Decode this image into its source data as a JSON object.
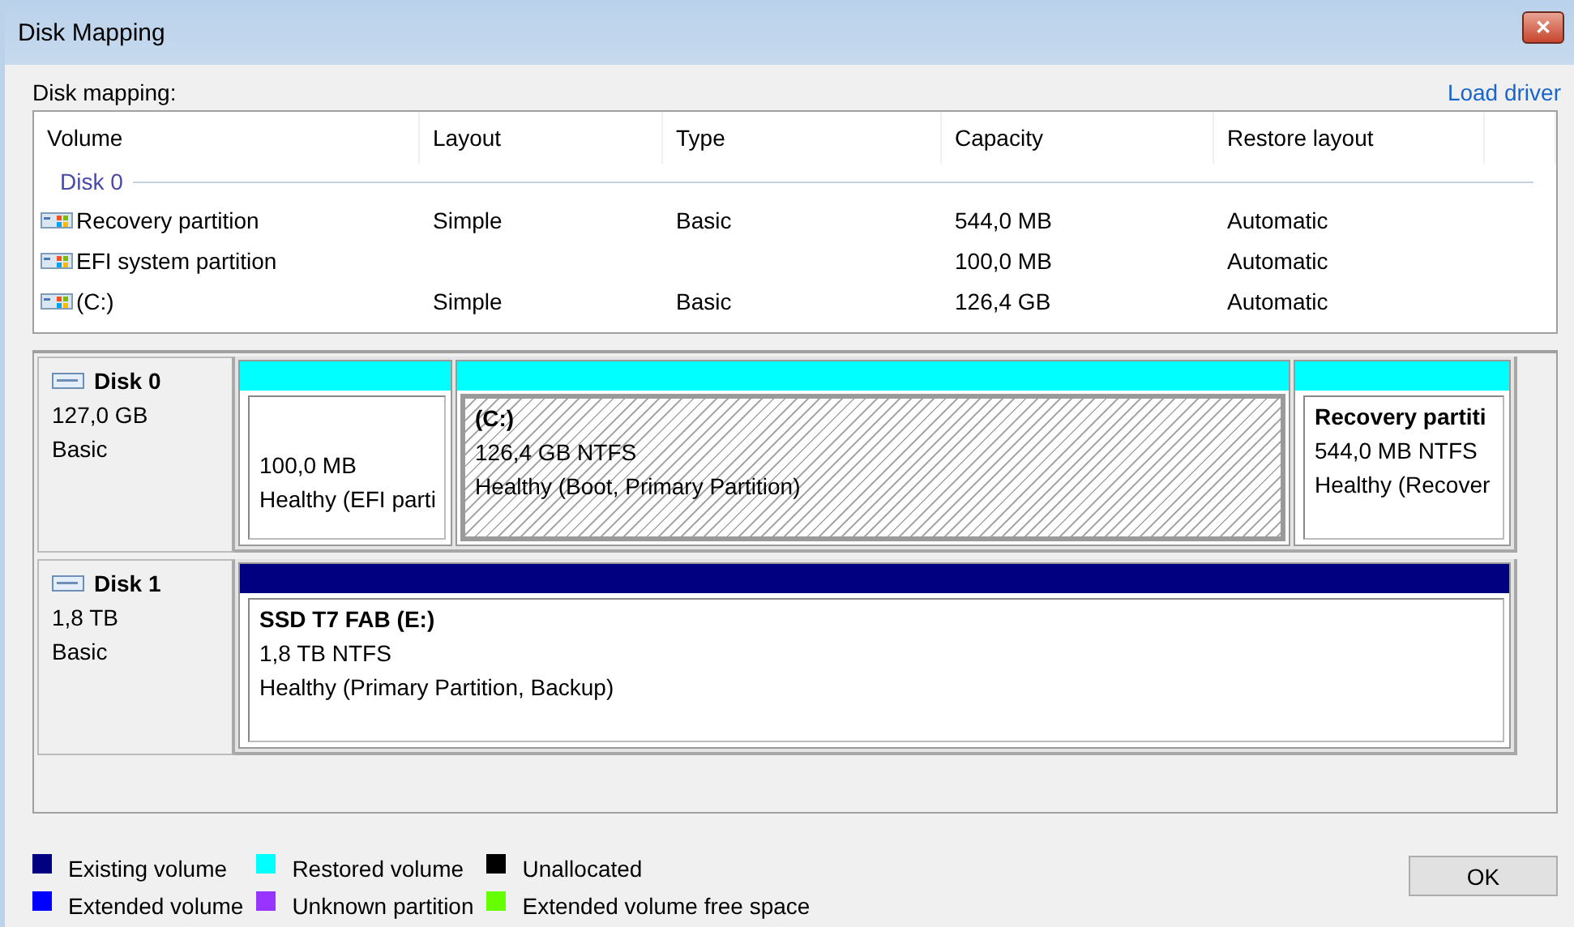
{
  "window": {
    "title": "Disk Mapping",
    "close": "✕"
  },
  "header": {
    "label": "Disk mapping:",
    "link": "Load driver"
  },
  "table": {
    "columns": [
      "Volume",
      "Layout",
      "Type",
      "Capacity",
      "Restore layout"
    ],
    "groups": [
      {
        "name": "Disk 0",
        "rows": [
          {
            "volume": "Recovery partition",
            "layout": "Simple",
            "type": "Basic",
            "capacity": "544,0 MB",
            "restore": "Automatic"
          },
          {
            "volume": "EFI system partition",
            "capacity": "100,0 MB",
            "restore": "Automatic"
          },
          {
            "volume": "(C:)",
            "layout": "Simple",
            "type": "Basic",
            "capacity": "126,4 GB",
            "restore": "Automatic"
          }
        ]
      }
    ]
  },
  "disks": [
    {
      "name": "Disk 0",
      "size": "127,0 GB",
      "type": "Basic",
      "partitions": [
        {
          "size": "100,0 MB",
          "status": "Healthy (EFI parti",
          "color": "#00ffff",
          "selected": false
        },
        {
          "name": "(C:)",
          "size": "126,4 GB NTFS",
          "status": "Healthy (Boot, Primary Partition)",
          "color": "#00ffff",
          "selected": true
        },
        {
          "name": "Recovery partiti",
          "size": "544,0 MB NTFS",
          "status": "Healthy (Recover",
          "color": "#00ffff",
          "selected": false
        }
      ]
    },
    {
      "name": "Disk 1",
      "size": "1,8 TB",
      "type": "Basic",
      "partitions": [
        {
          "name": "SSD T7 FAB (E:)",
          "size": "1,8 TB NTFS",
          "status": "Healthy (Primary Partition, Backup)",
          "color": "#000080",
          "selected": false
        }
      ]
    }
  ],
  "legend": [
    {
      "label": "Existing volume",
      "color": "#000080"
    },
    {
      "label": "Extended volume",
      "color": "#0000ff"
    },
    {
      "label": "Restored volume",
      "color": "#00ffff"
    },
    {
      "label": "Unknown partition",
      "color": "#9933ff"
    },
    {
      "label": "Unallocated",
      "color": "#000000"
    },
    {
      "label": "Extended volume free space",
      "color": "#66ff00"
    }
  ],
  "buttons": {
    "ok": "OK"
  }
}
